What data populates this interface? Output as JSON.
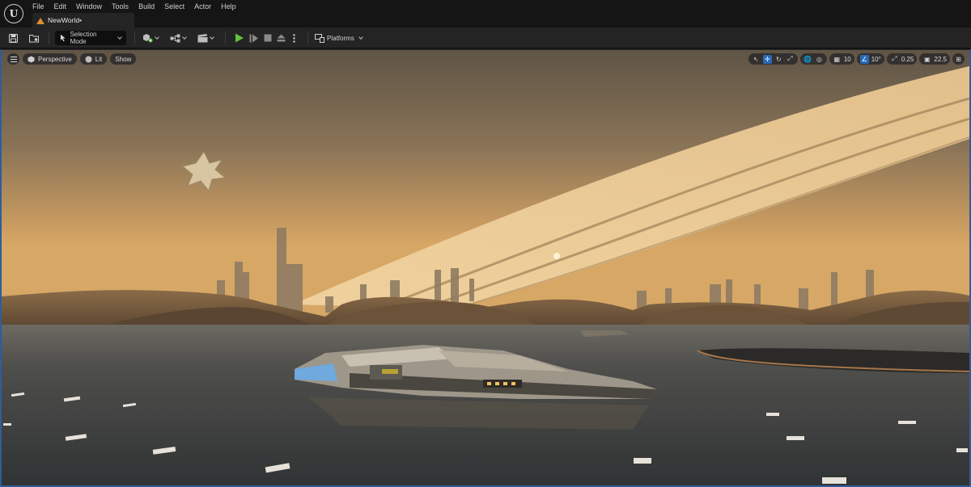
{
  "app": {
    "logo_letter": "U"
  },
  "menu": [
    "File",
    "Edit",
    "Window",
    "Tools",
    "Build",
    "Select",
    "Actor",
    "Help"
  ],
  "document_tab": {
    "label": "NewWorld•"
  },
  "toolbar": {
    "selection_mode": "Selection Mode",
    "platforms": "Platforms"
  },
  "viewport": {
    "perspective": "Perspective",
    "lit": "Lit",
    "show": "Show",
    "grid_snap": "10",
    "rotation_snap": "10°",
    "scale_snap": "0.25",
    "camera_speed": "22.5"
  },
  "colors": {
    "accent": "#2869b8",
    "play": "#5fc43a",
    "sky_top": "#6a5a45",
    "sky_horizon": "#d9a865",
    "water": "#3c3e3e"
  }
}
